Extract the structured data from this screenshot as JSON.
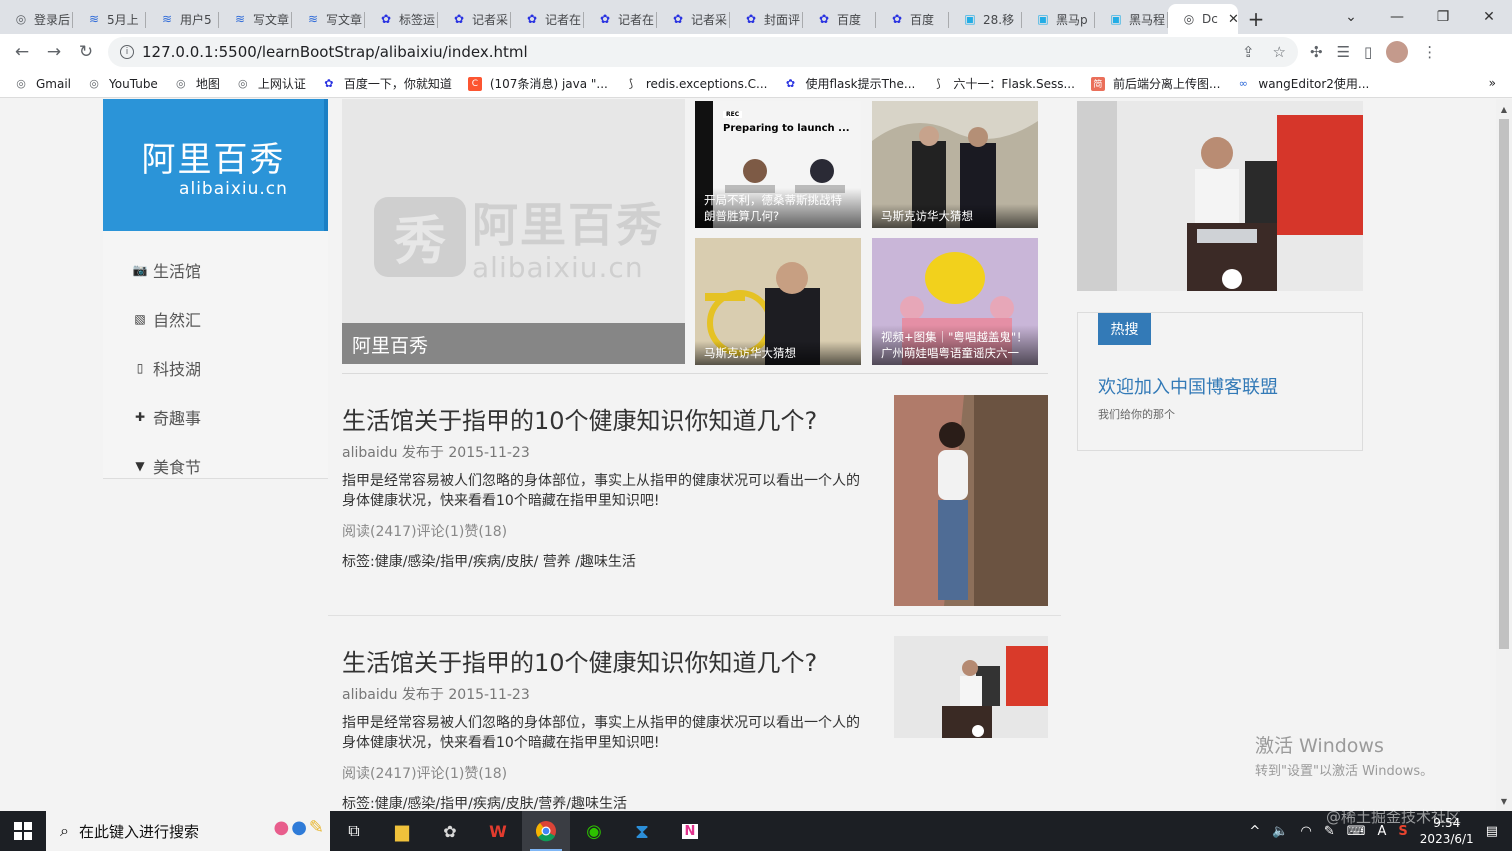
{
  "browser": {
    "tabs": [
      {
        "label": "登录后",
        "icon": "globe"
      },
      {
        "label": "5月上",
        "icon": "csdn"
      },
      {
        "label": "用户5",
        "icon": "csdn"
      },
      {
        "label": "写文章",
        "icon": "csdn"
      },
      {
        "label": "写文章",
        "icon": "csdn"
      },
      {
        "label": "标签运",
        "icon": "baidu"
      },
      {
        "label": "记者采",
        "icon": "baidu"
      },
      {
        "label": "记者在",
        "icon": "baidu"
      },
      {
        "label": "记者在",
        "icon": "baidu"
      },
      {
        "label": "记者采",
        "icon": "baidu"
      },
      {
        "label": "封面评",
        "icon": "baidu"
      },
      {
        "label": "百度",
        "icon": "baidu"
      },
      {
        "label": "百度",
        "icon": "baidu"
      },
      {
        "label": "28.移",
        "icon": "bilibili"
      },
      {
        "label": "黑马p",
        "icon": "bilibili"
      },
      {
        "label": "黑马程",
        "icon": "bilibili"
      }
    ],
    "active_tab": {
      "label": "Dc",
      "close": "✕"
    },
    "url": "127.0.0.1:5500/learnBootStrap/alibaixiu/index.html",
    "bookmarks": [
      {
        "label": "Gmail",
        "icon": "globe"
      },
      {
        "label": "YouTube",
        "icon": "globe"
      },
      {
        "label": "地图",
        "icon": "globe"
      },
      {
        "label": "上网认证",
        "icon": "globe"
      },
      {
        "label": "百度一下，你就知道",
        "icon": "baidu"
      },
      {
        "label": "(107条消息) java \"...",
        "icon": "csdn-c"
      },
      {
        "label": "redis.exceptions.C...",
        "icon": "fish"
      },
      {
        "label": "使用flask提示The...",
        "icon": "baidu"
      },
      {
        "label": "六十一：Flask.Sess...",
        "icon": "fish"
      },
      {
        "label": "前后端分离上传图...",
        "icon": "jian"
      },
      {
        "label": "wangEditor2使用...",
        "icon": "link"
      }
    ],
    "bookmarks_more": "»"
  },
  "page": {
    "brand": {
      "cn": "阿里百秀",
      "en": "alibaixiu.cn"
    },
    "nav": [
      {
        "label": "生活馆",
        "icon": "camera"
      },
      {
        "label": "自然汇",
        "icon": "picture"
      },
      {
        "label": "科技湖",
        "icon": "phone"
      },
      {
        "label": "奇趣事",
        "icon": "gift"
      },
      {
        "label": "美食节",
        "icon": "filter"
      }
    ],
    "hero": {
      "caption": "阿里百秀",
      "watermark_box": "秀",
      "watermark_cn": "阿里百秀",
      "watermark_en": "alibaixiu.cn"
    },
    "thumbs": [
      {
        "caption": "开局不利，德桑蒂斯挑战特朗普胜算几何?",
        "tag": "REC",
        "tagline": "Preparing to launch ..."
      },
      {
        "caption": "马斯克访华大猜想"
      },
      {
        "caption": "马斯克访华大猜想"
      },
      {
        "caption": "视频+图集｜\"粤唱越盖鬼\"！广州萌娃唱粤语童谣庆六一"
      }
    ],
    "articles": [
      {
        "title": "生活馆关于指甲的10个健康知识你知道几个?",
        "meta": "alibaidu 发布于 2015-11-23",
        "summary": "指甲是经常容易被人们忽略的身体部位，事实上从指甲的健康状况可以看出一个人的身体健康状况，快来看看10个暗藏在指甲里知识吧!",
        "stats": "阅读(2417)评论(1)赞(18)",
        "tags": "标签:健康/感染/指甲/疾病/皮肤/ 营养 /趣味生活"
      },
      {
        "title": "生活馆关于指甲的10个健康知识你知道几个?",
        "meta": "alibaidu 发布于 2015-11-23",
        "summary": "指甲是经常容易被人们忽略的身体部位，事实上从指甲的健康状况可以看出一个人的身体健康状况，快来看看10个暗藏在指甲里知识吧!",
        "stats": "阅读(2417)评论(1)赞(18)",
        "tags": "标签:健康/感染/指甲/疾病/皮肤/营养/趣味生活"
      }
    ],
    "hot": {
      "badge": "热搜",
      "link": "欢迎加入中国博客联盟",
      "sub": "我们给你的那个"
    }
  },
  "os": {
    "activate_title": "激活 Windows",
    "activate_sub": "转到\"设置\"以激活 Windows。",
    "search_placeholder": "在此键入进行搜索",
    "time": "9:54",
    "date": "2023/6/1",
    "ime": "A",
    "juejin": "@稀土掘金技术社区"
  },
  "colors": {
    "brand_blue": "#2b94d8",
    "link_blue": "#337ab7",
    "taskbar": "#1c1f24"
  }
}
